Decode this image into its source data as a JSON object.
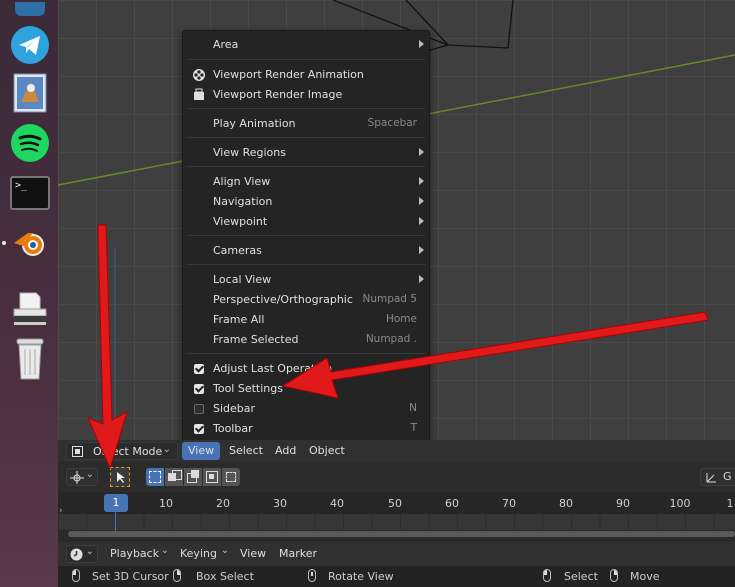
{
  "colors": {
    "accent": "#4772b3",
    "arrow": "#e01a1a",
    "menu_bg": "#242424",
    "dock_bg": "#4a2f3f"
  },
  "dock": {
    "apps": [
      {
        "name": "telegram-icon"
      },
      {
        "name": "mail-icon"
      },
      {
        "name": "spotify-icon"
      },
      {
        "name": "terminal-icon",
        "text": ">_"
      },
      {
        "name": "blender-icon"
      },
      {
        "name": "scanner-icon"
      },
      {
        "name": "trash-icon"
      }
    ]
  },
  "view_menu": {
    "items": [
      {
        "label": "Area",
        "submenu": true
      },
      {
        "label": "Viewport Render Animation",
        "icon": "film-icon"
      },
      {
        "label": "Viewport Render Image",
        "icon": "render-image-icon"
      },
      {
        "label": "Play Animation",
        "shortcut": "Spacebar"
      },
      {
        "label": "View Regions",
        "submenu": true
      },
      {
        "label": "Align View",
        "submenu": true
      },
      {
        "label": "Navigation",
        "submenu": true
      },
      {
        "label": "Viewpoint",
        "submenu": true
      },
      {
        "label": "Cameras",
        "submenu": true
      },
      {
        "label": "Local View",
        "submenu": true
      },
      {
        "label": "Perspective/Orthographic",
        "shortcut": "Numpad 5"
      },
      {
        "label": "Frame All",
        "shortcut": "Home"
      },
      {
        "label": "Frame Selected",
        "shortcut": "Numpad ."
      },
      {
        "label": "Adjust Last Operation",
        "checked": true
      },
      {
        "label": "Tool Settings",
        "checked": true
      },
      {
        "label": "Sidebar",
        "checked": false,
        "shortcut": "N"
      },
      {
        "label": "Toolbar",
        "checked": true,
        "shortcut": "T"
      }
    ]
  },
  "header": {
    "mode": "Object Mode",
    "menus": [
      "View",
      "Select",
      "Add",
      "Object"
    ],
    "active_menu": "View",
    "right_label": "G"
  },
  "timeline": {
    "current_frame": "1",
    "ticks": [
      "10",
      "20",
      "30",
      "40",
      "50",
      "60",
      "70",
      "80",
      "90",
      "100",
      "1"
    ],
    "menus": {
      "playback": "Playback",
      "keying": "Keying",
      "view": "View",
      "marker": "Marker"
    }
  },
  "status": {
    "set_cursor": "Set 3D Cursor",
    "box_select": "Box Select",
    "rotate_view": "Rotate View",
    "select": "Select",
    "move": "Move"
  }
}
